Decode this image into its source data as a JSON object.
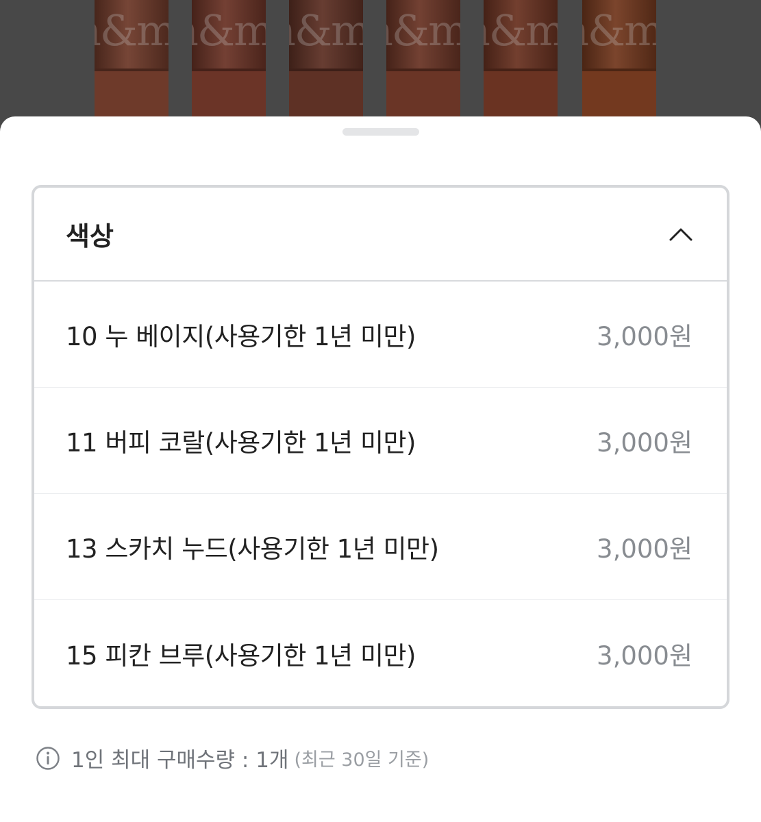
{
  "backdrop": {
    "tubes": [
      {
        "color": "#6e3a2a",
        "logo": "n&m"
      },
      {
        "color": "#6b3427",
        "logo": "n&m"
      },
      {
        "color": "#5e3125",
        "logo": "n&m"
      },
      {
        "color": "#6a3526",
        "logo": "n&m"
      },
      {
        "color": "#6a3322",
        "logo": "n&m"
      },
      {
        "color": "#73391f",
        "logo": "n&m"
      }
    ]
  },
  "option": {
    "title": "색상",
    "items": [
      {
        "name": "10 누 베이지(사용기한 1년 미만)",
        "price": "3,000원"
      },
      {
        "name": "11 버피 코랄(사용기한 1년 미만)",
        "price": "3,000원"
      },
      {
        "name": "13 스카치 누드(사용기한 1년 미만)",
        "price": "3,000원"
      },
      {
        "name": "15 피칸 브루(사용기한 1년 미만)",
        "price": "3,000원"
      }
    ]
  },
  "notice": {
    "main": "1인 최대 구매수량 : 1개",
    "sub": "(최근 30일 기준)"
  },
  "colors": {
    "sheet_bg": "#ffffff",
    "border": "#d5d7da",
    "text_primary": "#222222",
    "text_price": "#888c91"
  }
}
